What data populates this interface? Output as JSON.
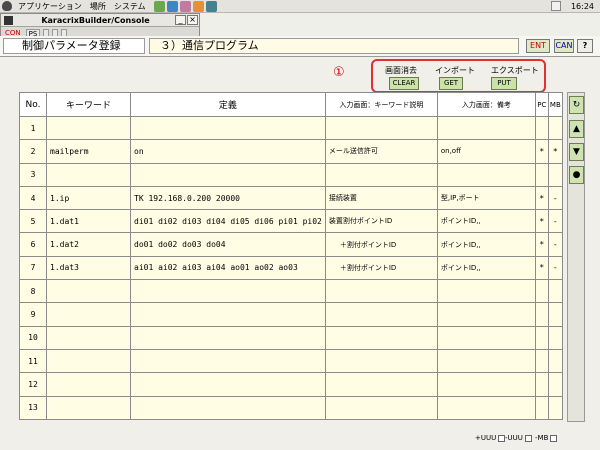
{
  "panel": {
    "menu_apps": "アプリケーション",
    "menu_places": "場所",
    "menu_system": "システム",
    "launcher_colors": [
      "#6aa84f",
      "#3d85c6",
      "#c27ba0",
      "#e69138",
      "#45818e"
    ],
    "clock": "16:24"
  },
  "console": {
    "title": "KaracrixBuilder/Console",
    "min": "_",
    "close": "×",
    "toolbar": [
      "CON",
      "PS",
      "",
      "",
      ""
    ]
  },
  "header": {
    "screen_title": "制御パラメータ登録",
    "screen_sub": "３）通信プログラム",
    "ent": "ENT",
    "can": "CAN",
    "help": "?"
  },
  "actions": {
    "marker": "①",
    "clear_label": "画面消去",
    "clear_btn": "CLEAR",
    "import_label": "インポート",
    "import_btn": "GET",
    "export_label": "エクスポート",
    "export_btn": "PUT"
  },
  "table": {
    "headers": [
      "No.",
      "キーワード",
      "定義",
      "入力画面：キーワード説明",
      "入力画面：備考",
      "PC",
      "MB"
    ],
    "rows": [
      {
        "no": "1",
        "keyword": "",
        "definition": "",
        "desc": "",
        "note": "",
        "pc": "",
        "mb": ""
      },
      {
        "no": "2",
        "keyword": "mailperm",
        "definition": "on",
        "desc": "メール送信許可",
        "note": "on,off",
        "pc": "*",
        "mb": "*"
      },
      {
        "no": "3",
        "keyword": "",
        "definition": "",
        "desc": "",
        "note": "",
        "pc": "",
        "mb": ""
      },
      {
        "no": "4",
        "keyword": "1.ip",
        "definition": "TK 192.168.0.200 20000",
        "desc": "接続装置",
        "note": "型,IP,ポート",
        "pc": "*",
        "mb": "-"
      },
      {
        "no": "5",
        "keyword": "1.dat1",
        "definition": "di01 di02 di03 di04 di05 di06 pi01 pi02",
        "desc": "装置割付ポイントID",
        "note": "ポイントID,,",
        "pc": "*",
        "mb": "-"
      },
      {
        "no": "6",
        "keyword": "1.dat2",
        "definition": "do01 do02 do03 do04",
        "desc": "＋割付ポイントID",
        "note": "ポイントID,,",
        "pc": "*",
        "mb": "-"
      },
      {
        "no": "7",
        "keyword": "1.dat3",
        "definition": "ai01 ai02 ai03 ai04 ao01 ao02 ao03",
        "desc": "＋割付ポイントID",
        "note": "ポイントID,,",
        "pc": "*",
        "mb": "-"
      },
      {
        "no": "8",
        "keyword": "",
        "definition": "",
        "desc": "",
        "note": "",
        "pc": "",
        "mb": ""
      },
      {
        "no": "9",
        "keyword": "",
        "definition": "",
        "desc": "",
        "note": "",
        "pc": "",
        "mb": ""
      },
      {
        "no": "10",
        "keyword": "",
        "definition": "",
        "desc": "",
        "note": "",
        "pc": "",
        "mb": ""
      },
      {
        "no": "11",
        "keyword": "",
        "definition": "",
        "desc": "",
        "note": "",
        "pc": "",
        "mb": ""
      },
      {
        "no": "12",
        "keyword": "",
        "definition": "",
        "desc": "",
        "note": "",
        "pc": "",
        "mb": ""
      },
      {
        "no": "13",
        "keyword": "",
        "definition": "",
        "desc": "",
        "note": "",
        "pc": "",
        "mb": ""
      }
    ]
  },
  "side": {
    "refresh": "↻",
    "up": "▲",
    "down": "▼",
    "dot": "●"
  },
  "bottom": {
    "plus_uuu": "+UUU",
    "minus_uuu": "-UUU",
    "minus_mb": "-MB"
  }
}
